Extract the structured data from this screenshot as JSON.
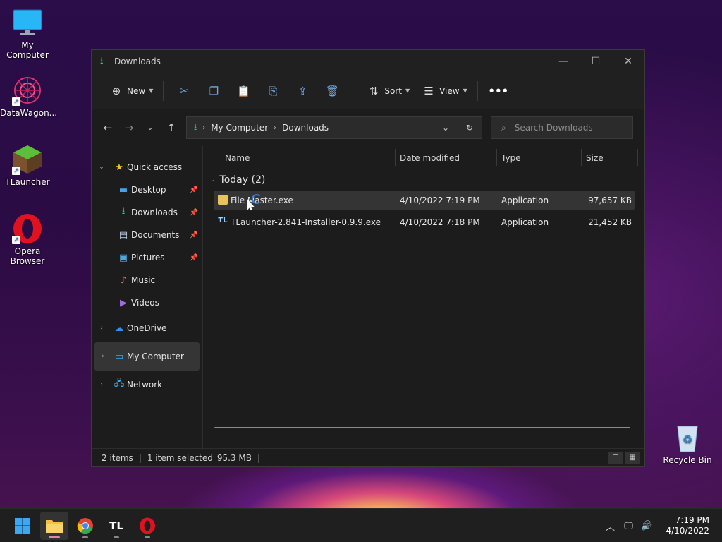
{
  "desktop": {
    "icons": [
      {
        "label": "My Computer"
      },
      {
        "label": "DataWagon..."
      },
      {
        "label": "TLauncher"
      },
      {
        "label": "Opera Browser"
      },
      {
        "label": "Recycle Bin"
      }
    ]
  },
  "window": {
    "title": "Downloads",
    "toolbar": {
      "new_label": "New",
      "sort_label": "Sort",
      "view_label": "View"
    },
    "address": {
      "crumbs": [
        "My Computer",
        "Downloads"
      ]
    },
    "search": {
      "placeholder": "Search Downloads"
    },
    "sidebar": {
      "quick_access": "Quick access",
      "items": [
        {
          "label": "Desktop",
          "pinned": true
        },
        {
          "label": "Downloads",
          "pinned": true
        },
        {
          "label": "Documents",
          "pinned": true
        },
        {
          "label": "Pictures",
          "pinned": true
        },
        {
          "label": "Music",
          "pinned": false
        },
        {
          "label": "Videos",
          "pinned": false
        }
      ],
      "onedrive": "OneDrive",
      "my_computer": "My Computer",
      "network": "Network"
    },
    "columns": {
      "name": "Name",
      "date": "Date modified",
      "type": "Type",
      "size": "Size"
    },
    "group": {
      "label": "Today (2)"
    },
    "files": [
      {
        "name": "File Master.exe",
        "date": "4/10/2022 7:19 PM",
        "type": "Application",
        "size": "97,657 KB",
        "selected": true
      },
      {
        "name": "TLauncher-2.841-Installer-0.9.9.exe",
        "date": "4/10/2022 7:18 PM",
        "type": "Application",
        "size": "21,452 KB",
        "selected": false
      }
    ],
    "status": {
      "items": "2 items",
      "selected": "1 item selected",
      "size": "95.3 MB"
    }
  },
  "taskbar": {
    "time": "7:19 PM",
    "date": "4/10/2022"
  },
  "colors": {
    "accent": "#3b7bd9",
    "download_green": "#3fc37a",
    "window_bg": "#1c1c1c"
  }
}
